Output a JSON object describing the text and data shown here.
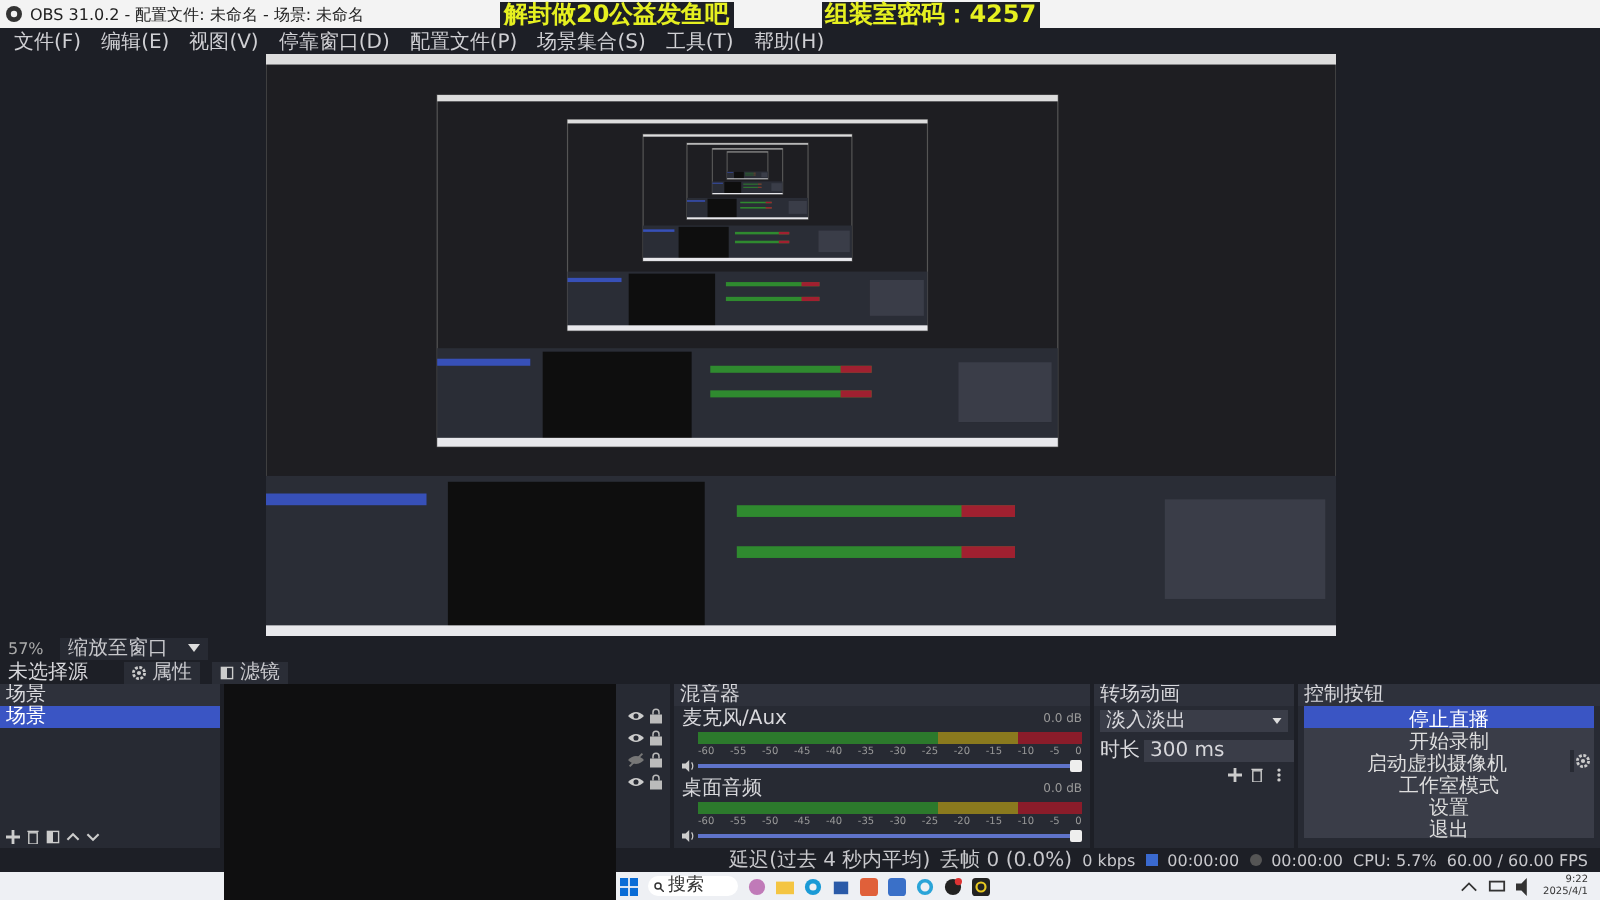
{
  "window": {
    "title": "OBS 31.0.2 - 配置文件: 未命名 - 场景: 未命名"
  },
  "overlay_texts": [
    "解封做20公益发鱼吧",
    "组装室密码：4257"
  ],
  "menu": [
    "文件(F)",
    "编辑(E)",
    "视图(V)",
    "停靠窗口(D)",
    "配置文件(P)",
    "场景集合(S)",
    "工具(T)",
    "帮助(H)"
  ],
  "preview": {
    "zoom": "57%",
    "scale_mode": "缩放至窗口"
  },
  "source_toolbar": {
    "label": "未选择源",
    "buttons": [
      "属性",
      "滤镜"
    ]
  },
  "scenes": {
    "header": "场景",
    "items": [
      {
        "name": "场景",
        "selected": true
      }
    ]
  },
  "sources": {
    "items": [
      {
        "visible": true
      },
      {
        "visible": true
      },
      {
        "visible": false
      },
      {
        "visible": true
      }
    ]
  },
  "mixer": {
    "title": "混音器",
    "channels": [
      {
        "name": "麦克风/Aux",
        "reading": "0.0 dB",
        "level": 1,
        "ticks": [
          "-60",
          "-55",
          "-50",
          "-45",
          "-40",
          "-35",
          "-30",
          "-25",
          "-20",
          "-15",
          "-10",
          "-5",
          "0"
        ]
      },
      {
        "name": "桌面音频",
        "reading": "0.0 dB",
        "level": 1,
        "ticks": [
          "-60",
          "-55",
          "-50",
          "-45",
          "-40",
          "-35",
          "-30",
          "-25",
          "-20",
          "-15",
          "-10",
          "-5",
          "0"
        ]
      }
    ]
  },
  "transitions": {
    "title": "转场动画",
    "type": "淡入淡出",
    "duration_label": "时长",
    "duration": "300 ms"
  },
  "controls": {
    "title": "控制按钮",
    "buttons": [
      {
        "label": "停止直播",
        "active": true
      },
      {
        "label": "开始录制",
        "active": false
      },
      {
        "label": "启动虚拟摄像机",
        "active": false
      },
      {
        "label": "工作室模式",
        "active": false
      },
      {
        "label": "设置",
        "active": false
      },
      {
        "label": "退出",
        "active": false
      }
    ]
  },
  "status": [
    "延迟(过去 4 秒内平均)",
    "丢帧 0 (0.0%)",
    "0 kbps",
    "00:00:00",
    "00:00:00",
    "CPU: 5.7%",
    "60.00 / 60.00 FPS"
  ],
  "taskbar": {
    "search": "搜索",
    "time": "9:22",
    "date": "2025/4/1"
  }
}
